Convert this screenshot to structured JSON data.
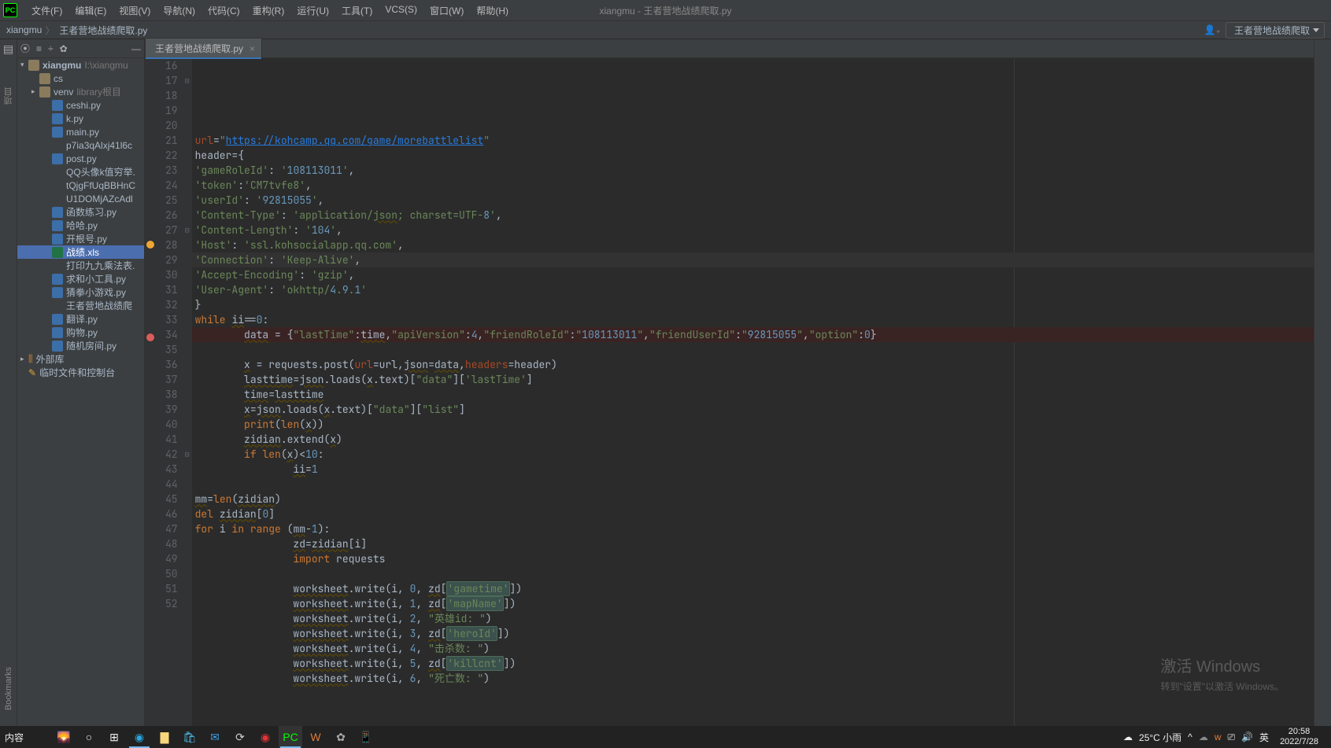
{
  "titlebar": {
    "window_title": "xiangmu - 王者营地战绩爬取.py",
    "menus": [
      "文件(F)",
      "编辑(E)",
      "视图(V)",
      "导航(N)",
      "代码(C)",
      "重构(R)",
      "运行(U)",
      "工具(T)",
      "VCS(S)",
      "窗口(W)",
      "帮助(H)"
    ]
  },
  "navbar": {
    "crumb1": "xiangmu",
    "crumb2": "王者营地战绩爬取.py",
    "runconfig": "王者营地战绩爬取"
  },
  "left_gutter": {
    "project_label": "项目",
    "bookmarks_label": "Bookmarks"
  },
  "tree": {
    "root": "xiangmu",
    "root_path": "I:\\xiangmu",
    "folder_cs": "cs",
    "folder_venv": "venv",
    "venv_hint": "library根目",
    "files": [
      "ceshi.py",
      "k.py",
      "main.py",
      "p7ia3qAlxj41l6c",
      "post.py",
      "QQ头像k值穷举.",
      "tQjgFfUqBBHnC",
      "U1DOMjAZcAdl",
      "函数练习.py",
      "哈哈.py",
      "开根号.py"
    ],
    "file_selected": "战绩.xls",
    "files2": [
      "打印九九乘法表.",
      "求和小工具.py",
      "猜拳小游戏.py",
      "王者营地战绩爬",
      "翻译.py",
      "购物.py",
      "随机房间.py"
    ],
    "ext_lib": "外部库",
    "scratch": "临时文件和控制台"
  },
  "tab": {
    "name": "王者营地战绩爬取.py"
  },
  "code": {
    "line_start": 16,
    "lines": [
      "url=\"https://kohcamp.qq.com/game/morebattlelist\"",
      "header={",
      "'gameRoleId': '108113011',",
      "'token':'CM7tvfe8',",
      "'userId': '92815055',",
      "'Content-Type': 'application/json; charset=UTF-8',",
      "'Content-Length': '104',",
      "'Host': 'ssl.kohsocialapp.qq.com',",
      "'Connection': 'Keep-Alive',",
      "'Accept-Encoding': 'gzip',",
      "'User-Agent': 'okhttp/4.9.1'",
      "}",
      "while ii==0:",
      "    data = {\"lastTime\":time,\"apiVersion\":4,\"friendRoleId\":\"108113011\",\"friendUserId\":\"92815055\",\"option\":0}",
      "",
      "    x = requests.post(url=url,json=data,headers=header)",
      "    lasttime=json.loads(x.text)[\"data\"]['lastTime']",
      "    time=lasttime",
      "    x=json.loads(x.text)[\"data\"][\"list\"]",
      "    print(len(x))",
      "    zidian.extend(x)",
      "    if len(x)<10:",
      "        ii=1",
      "",
      "mm=len(zidian)",
      "del zidian[0]",
      "for i in range (mm-1):",
      "        zd=zidian[i]",
      "        import requests",
      "",
      "        worksheet.write(i, 0, zd['gametime'])",
      "        worksheet.write(i, 1, zd['mapName'])",
      "        worksheet.write(i, 2, \"英雄id: \")",
      "        worksheet.write(i, 3, zd['heroId'])",
      "        worksheet.write(i, 4, \"击杀数: \")",
      "        worksheet.write(i, 5, zd['killcnt'])",
      "        worksheet.write(i, 6, \"死亡数: \")"
    ]
  },
  "watermark": {
    "title": "激活 Windows",
    "sub": "转到\"设置\"以激活 Windows。"
  },
  "taskbar": {
    "start_label": "内容",
    "weather": "25°C 小雨",
    "ime": "英",
    "time": "20:58",
    "date": "2022/7/28"
  }
}
